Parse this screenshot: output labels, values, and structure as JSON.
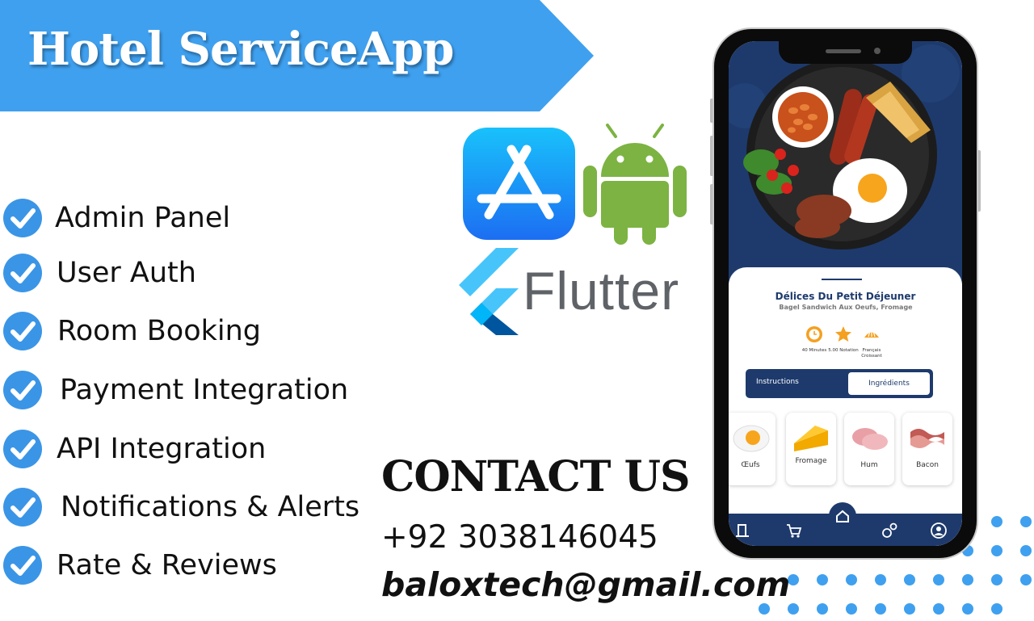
{
  "banner": {
    "title": "Hotel ServiceApp"
  },
  "colors": {
    "banner": "#3fa0ef",
    "check": "#3b95e6",
    "navy": "#1e3a6d",
    "android": "#7cb342",
    "appstore": "#1e8ff2",
    "dots": "#3fa0ef"
  },
  "features": [
    {
      "label": "Admin Panel"
    },
    {
      "label": "User Auth"
    },
    {
      "label": "Room Booking"
    },
    {
      "label": "Payment Integration"
    },
    {
      "label": "API Integration"
    },
    {
      "label": "Notifications & Alerts"
    },
    {
      "label": "Rate & Reviews"
    }
  ],
  "platforms": {
    "flutter": "Flutter",
    "icons": [
      "app-store-icon",
      "android-icon",
      "flutter-icon"
    ]
  },
  "contact": {
    "heading": "CONTACT US",
    "phone": "+92 3038146045",
    "email": "baloxtech@gmail.com"
  },
  "phone_app": {
    "dish_title": "Délices Du Petit Déjeuner",
    "dish_subtitle": "Bagel Sandwich Aux Oeufs, Fromage",
    "stats": [
      {
        "icon": "clock-icon",
        "label": "40 Minutes"
      },
      {
        "icon": "star-icon",
        "label": "5.00 Notation"
      },
      {
        "icon": "croissant-icon",
        "label": "Français Croissant"
      }
    ],
    "tabs": {
      "instructions": "Instructions",
      "ingredients": "Ingrédients"
    },
    "ingredients": [
      {
        "label": "Œufs"
      },
      {
        "label": "Fromage"
      },
      {
        "label": "Hum"
      },
      {
        "label": "Bacon"
      }
    ],
    "nav_icons": [
      "door-icon",
      "cart-icon",
      "home-icon",
      "settings-icon",
      "profile-icon"
    ]
  }
}
